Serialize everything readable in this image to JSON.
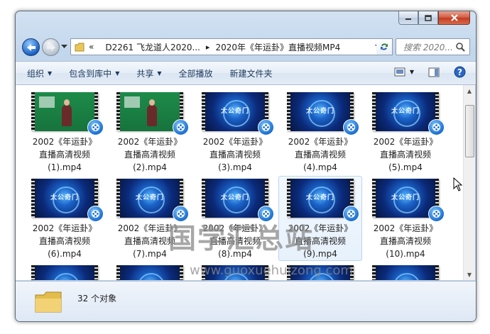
{
  "address": {
    "overflow": "«",
    "crumbs": [
      "D2261 飞龙道人2020...",
      "2020年《年运卦》直播视频MP4"
    ],
    "separator": "▸"
  },
  "search": {
    "placeholder": "搜索 2020..."
  },
  "toolbar": {
    "organize": "组织",
    "include_in_library": "包含到库中",
    "share": "共享",
    "play_all": "全部播放",
    "new_folder": "新建文件夹"
  },
  "files": [
    {
      "line1": "2002《年运卦》",
      "line2": "直播高清视频",
      "line3": "(1).mp4",
      "thumb": "green"
    },
    {
      "line1": "2002《年运卦》",
      "line2": "直播高清视频",
      "line3": "(2).mp4",
      "thumb": "green"
    },
    {
      "line1": "2002《年运卦》",
      "line2": "直播高清视频",
      "line3": "(3).mp4",
      "thumb": "blue"
    },
    {
      "line1": "2002《年运卦》",
      "line2": "直播高清视频",
      "line3": "(4).mp4",
      "thumb": "blue"
    },
    {
      "line1": "2002《年运卦》",
      "line2": "直播高清视频",
      "line3": "(5).mp4",
      "thumb": "blue"
    },
    {
      "line1": "2002《年运卦》",
      "line2": "直播高清视频",
      "line3": "(6).mp4",
      "thumb": "blue"
    },
    {
      "line1": "2002《年运卦》",
      "line2": "直播高清视频",
      "line3": "(7).mp4",
      "thumb": "blue"
    },
    {
      "line1": "2002《年运卦》",
      "line2": "直播高清视频",
      "line3": "(8).mp4",
      "thumb": "blue"
    },
    {
      "line1": "2002《年运卦》",
      "line2": "直播高清视频",
      "line3": "(9).mp4",
      "thumb": "blue",
      "selected": true
    },
    {
      "line1": "2002《年运卦》",
      "line2": "直播高清视频",
      "line3": "(10).mp4",
      "thumb": "blue"
    },
    {
      "line1": "",
      "line2": "",
      "line3": "",
      "thumb": "blue"
    },
    {
      "line1": "",
      "line2": "",
      "line3": "",
      "thumb": "blue"
    },
    {
      "line1": "",
      "line2": "",
      "line3": "",
      "thumb": "blue"
    },
    {
      "line1": "",
      "line2": "",
      "line3": "",
      "thumb": "blue"
    },
    {
      "line1": "",
      "line2": "",
      "line3": "",
      "thumb": "blue"
    }
  ],
  "thumb_caption": "太公奇门",
  "watermark": {
    "text": "国学汇总站",
    "url": "www.guoxuehuizong.com"
  },
  "status": {
    "count": "32 个对象"
  },
  "colors": {
    "accent": "#1b63c4",
    "toolbar_text": "#1e395b",
    "selection": "#bcd6f0"
  }
}
